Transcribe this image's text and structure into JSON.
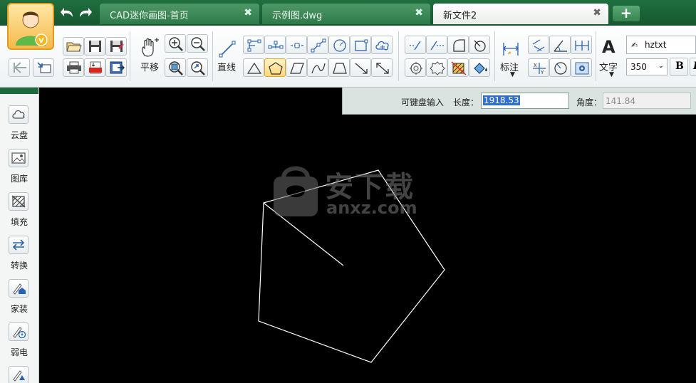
{
  "tabs": [
    {
      "label": "CAD迷你画图-首页",
      "active": false
    },
    {
      "label": "示例图.dwg",
      "active": false
    },
    {
      "label": "新文件2",
      "active": true
    }
  ],
  "tab_close_glyph": "✖",
  "tab_add_glyph": "+",
  "avatar_badge": "V",
  "ribbon": {
    "pan_label": "平移",
    "line_label": "直线",
    "dimension_label": "标注",
    "text_label": "文字",
    "text_icon_glyph": "A",
    "font_name": "hztxt",
    "font_size": "350",
    "bold_glyph": "B",
    "italic_glyph": "I"
  },
  "sidebar": {
    "items": [
      {
        "label": "云盘",
        "icon": "cloud-icon"
      },
      {
        "label": "图库",
        "icon": "gallery-icon"
      },
      {
        "label": "填充",
        "icon": "hatch-icon"
      },
      {
        "label": "转换",
        "icon": "convert-icon"
      },
      {
        "label": "家装",
        "icon": "home-decor-icon"
      },
      {
        "label": "弱电",
        "icon": "low-voltage-icon"
      }
    ]
  },
  "input_panel": {
    "title": "可键盘输入",
    "length_label": "长度：",
    "length_value": "1918.53",
    "angle_label": "角度：",
    "angle_value": "141.84"
  },
  "watermark": {
    "text_cn": "安下载",
    "text_en": "anxz.com"
  },
  "colors": {
    "accent_green": "#1f6f3f",
    "canvas": "#000000",
    "selection": "#2f6fd0"
  }
}
